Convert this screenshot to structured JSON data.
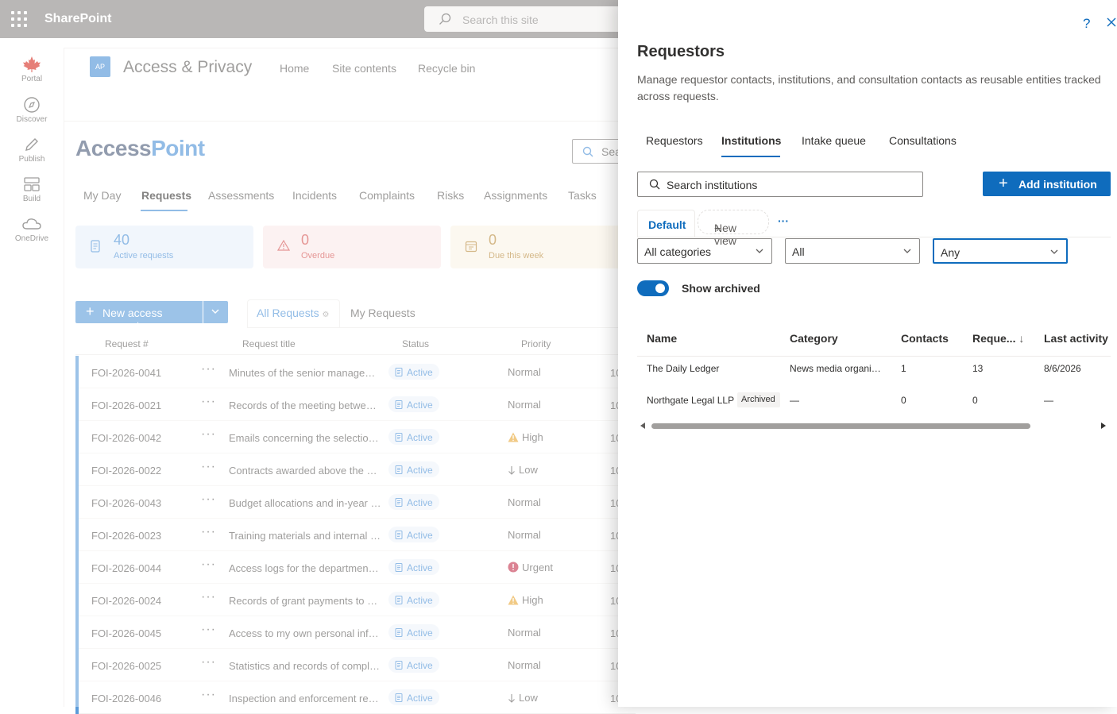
{
  "topbar": {
    "brand": "SharePoint",
    "search_placeholder": "Search this site"
  },
  "appbar": [
    {
      "label": "Portal",
      "icon": "maple-leaf-icon"
    },
    {
      "label": "Discover",
      "icon": "compass-icon"
    },
    {
      "label": "Publish",
      "icon": "pen-icon"
    },
    {
      "label": "Build",
      "icon": "blocks-icon"
    },
    {
      "label": "OneDrive",
      "icon": "cloud-icon"
    }
  ],
  "site": {
    "initials": "AP",
    "name": "Access & Privacy",
    "nav": [
      "Home",
      "Site contents",
      "Recycle bin"
    ]
  },
  "logo": {
    "part1": "Access",
    "part2": "Point"
  },
  "page_search_placeholder": "Sea",
  "tabs": [
    "My Day",
    "Requests",
    "Assessments",
    "Incidents",
    "Complaints",
    "Risks",
    "Assignments",
    "Tasks"
  ],
  "stats": [
    {
      "num": "40",
      "label": "Active requests",
      "color": "#4a8fd6",
      "bg": "#e8f1fb"
    },
    {
      "num": "0",
      "label": "Overdue",
      "color": "#d4504f",
      "bg": "#fbe9e9"
    },
    {
      "num": "0",
      "label": "Due this week",
      "color": "#b8893a",
      "bg": "#faf3e6"
    }
  ],
  "new_request_label": "New access request",
  "views": [
    "All Requests",
    "My Requests"
  ],
  "columns": [
    "Request #",
    "Request title",
    "Status",
    "Priority"
  ],
  "rows": [
    {
      "id": "FOI-2026-0041",
      "title": "Minutes of the senior management meetings",
      "status": "Active",
      "priority": "Normal",
      "picon": "",
      "extra": "10"
    },
    {
      "id": "FOI-2026-0021",
      "title": "Records of the meeting between officials",
      "status": "Active",
      "priority": "Normal",
      "picon": "",
      "extra": "10"
    },
    {
      "id": "FOI-2026-0042",
      "title": "Emails concerning the selection process",
      "status": "Active",
      "priority": "High",
      "picon": "warning-icon",
      "extra": "10"
    },
    {
      "id": "FOI-2026-0022",
      "title": "Contracts awarded above the procurement threshold",
      "status": "Active",
      "priority": "Low",
      "picon": "arrow-down-icon",
      "extra": "10"
    },
    {
      "id": "FOI-2026-0043",
      "title": "Budget allocations and in-year reallocations",
      "status": "Active",
      "priority": "Normal",
      "picon": "",
      "extra": "10"
    },
    {
      "id": "FOI-2026-0023",
      "title": "Training materials and internal guidance",
      "status": "Active",
      "priority": "Normal",
      "picon": "",
      "extra": "10"
    },
    {
      "id": "FOI-2026-0044",
      "title": "Access logs for the department database",
      "status": "Active",
      "priority": "Urgent",
      "picon": "urgent-icon",
      "extra": "10"
    },
    {
      "id": "FOI-2026-0024",
      "title": "Records of grant payments to applicants",
      "status": "Active",
      "priority": "High",
      "picon": "warning-icon",
      "extra": "10"
    },
    {
      "id": "FOI-2026-0045",
      "title": "Access to my own personal information",
      "status": "Active",
      "priority": "Normal",
      "picon": "",
      "extra": "10"
    },
    {
      "id": "FOI-2026-0025",
      "title": "Statistics and records of complaints received",
      "status": "Active",
      "priority": "Normal",
      "picon": "",
      "extra": "10"
    },
    {
      "id": "FOI-2026-0046",
      "title": "Inspection and enforcement records",
      "status": "Active",
      "priority": "Low",
      "picon": "arrow-down-icon",
      "extra": "10"
    }
  ],
  "panel": {
    "title": "Requestors",
    "description": "Manage requestor contacts, institutions, and consultation contacts as reusable entities tracked across requests.",
    "help": "?",
    "tabs": [
      "Requestors",
      "Institutions",
      "Intake queue",
      "Consultations"
    ],
    "search_placeholder": "Search institutions",
    "add_label": "Add institution",
    "view_default": "Default",
    "new_view_label": "New view",
    "more_label": "···",
    "filters": [
      "All categories",
      "All",
      "Any"
    ],
    "toggle_label": "Show archived",
    "table_headers": [
      "Name",
      "Category",
      "Contacts",
      "Reque...",
      "Last activity"
    ],
    "rows": [
      {
        "name": "The Daily Ledger",
        "tag": "",
        "category": "News media organization",
        "contacts": "1",
        "requests": "13",
        "last": "8/6/2026"
      },
      {
        "name": "Northgate Legal LLP",
        "tag": "Archived",
        "category": "—",
        "contacts": "0",
        "requests": "0",
        "last": "—"
      }
    ]
  }
}
